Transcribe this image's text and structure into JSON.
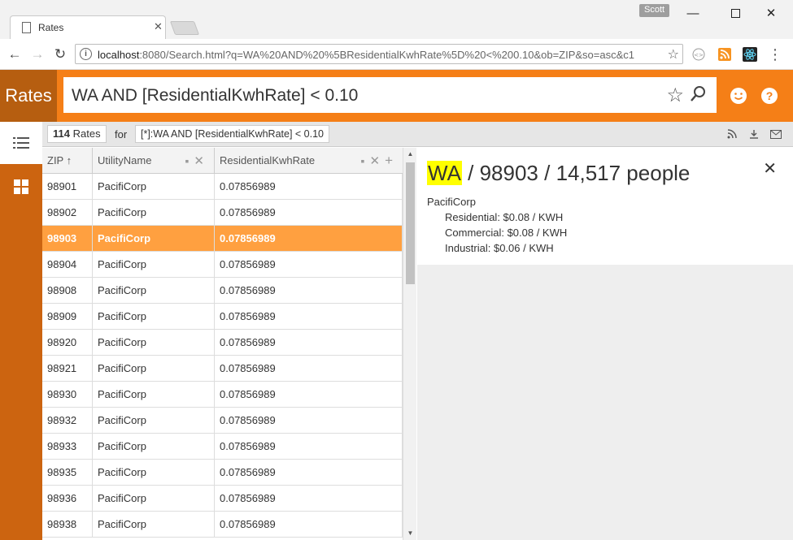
{
  "browser": {
    "tab_title": "Rates",
    "user": "Scott",
    "url_host": "localhost",
    "url_rest": ":8080/Search.html?q=WA%20AND%20%5BResidentialKwhRate%5D%20<%200.10&ob=ZIP&so=asc&c1"
  },
  "app": {
    "brand": "Rates",
    "query": "WA AND [ResidentialKwhRate] < 0.10"
  },
  "summary": {
    "count": "114",
    "count_label": "Rates",
    "for_label": "for",
    "query_display": "[*]:WA AND [ResidentialKwhRate] < 0.10"
  },
  "grid": {
    "columns": [
      "ZIP ↑",
      "UtilityName",
      "ResidentialKwhRate"
    ],
    "rows": [
      {
        "zip": "98901",
        "utility": "PacifiCorp",
        "rate": "0.07856989",
        "selected": false
      },
      {
        "zip": "98902",
        "utility": "PacifiCorp",
        "rate": "0.07856989",
        "selected": false
      },
      {
        "zip": "98903",
        "utility": "PacifiCorp",
        "rate": "0.07856989",
        "selected": true
      },
      {
        "zip": "98904",
        "utility": "PacifiCorp",
        "rate": "0.07856989",
        "selected": false
      },
      {
        "zip": "98908",
        "utility": "PacifiCorp",
        "rate": "0.07856989",
        "selected": false
      },
      {
        "zip": "98909",
        "utility": "PacifiCorp",
        "rate": "0.07856989",
        "selected": false
      },
      {
        "zip": "98920",
        "utility": "PacifiCorp",
        "rate": "0.07856989",
        "selected": false
      },
      {
        "zip": "98921",
        "utility": "PacifiCorp",
        "rate": "0.07856989",
        "selected": false
      },
      {
        "zip": "98930",
        "utility": "PacifiCorp",
        "rate": "0.07856989",
        "selected": false
      },
      {
        "zip": "98932",
        "utility": "PacifiCorp",
        "rate": "0.07856989",
        "selected": false
      },
      {
        "zip": "98933",
        "utility": "PacifiCorp",
        "rate": "0.07856989",
        "selected": false
      },
      {
        "zip": "98935",
        "utility": "PacifiCorp",
        "rate": "0.07856989",
        "selected": false
      },
      {
        "zip": "98936",
        "utility": "PacifiCorp",
        "rate": "0.07856989",
        "selected": false
      },
      {
        "zip": "98938",
        "utility": "PacifiCorp",
        "rate": "0.07856989",
        "selected": false
      }
    ]
  },
  "detail": {
    "state": "WA",
    "rest": " / 98903 / 14,517 people",
    "utility": "PacifiCorp",
    "rates": [
      "Residential: $0.08 / KWH",
      "Commercial: $0.08 / KWH",
      "Industrial: $0.06 / KWH"
    ]
  },
  "colors": {
    "accent": "#f57f17",
    "brand_bg": "#b65e10",
    "rail_bg": "#cc6410",
    "selected_row": "#ffa040",
    "highlight": "#ffff00"
  }
}
